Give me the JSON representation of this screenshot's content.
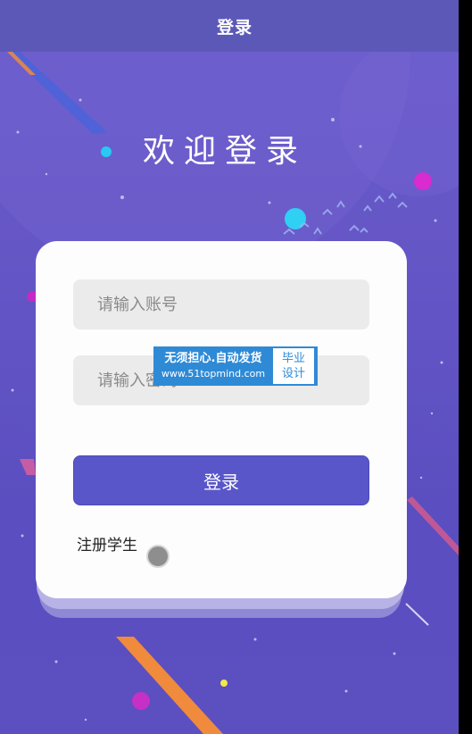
{
  "header": {
    "title": "登录"
  },
  "welcome": {
    "text": "欢迎登录"
  },
  "form": {
    "account_placeholder": "请输入账号",
    "password_placeholder": "请输入密码",
    "login_label": "登录",
    "register_label": "注册学生"
  },
  "watermark": {
    "line1": "无须担心.自动发货",
    "line2": "www.51topmind.com",
    "badge_line1": "毕业",
    "badge_line2": "设计"
  },
  "colors": {
    "background": "#6556c6",
    "topbar": "#5b58b8",
    "button": "#5956c9",
    "card": "#fdfdfd",
    "input": "#ebebeb"
  }
}
